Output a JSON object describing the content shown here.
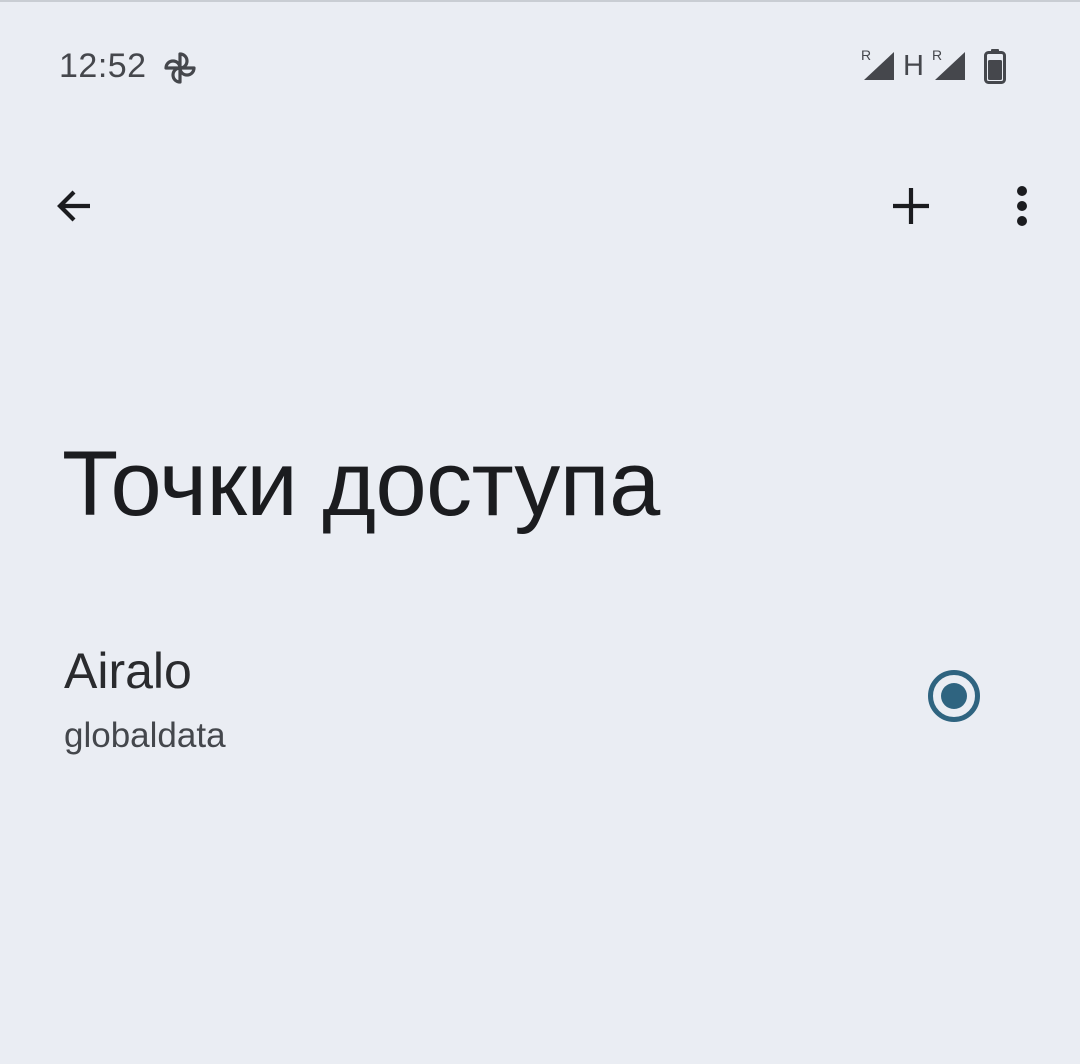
{
  "status_bar": {
    "time": "12:52",
    "icons": [
      "pinwheel-icon",
      "signal-roaming-icon",
      "signal-roaming-icon",
      "battery-icon"
    ],
    "network_type": "H",
    "roaming_marker": "R"
  },
  "app_bar": {
    "back_icon": "arrow-back-icon",
    "add_icon": "add-icon",
    "more_icon": "more-vert-icon"
  },
  "page": {
    "title": "Точки доступа"
  },
  "apn_list": [
    {
      "name": "Airalo",
      "apn": "globaldata",
      "selected": true
    }
  ],
  "colors": {
    "background": "#eaedf3",
    "accent": "#2f6480",
    "icon": "#1b1c1f",
    "status": "#45474c"
  }
}
